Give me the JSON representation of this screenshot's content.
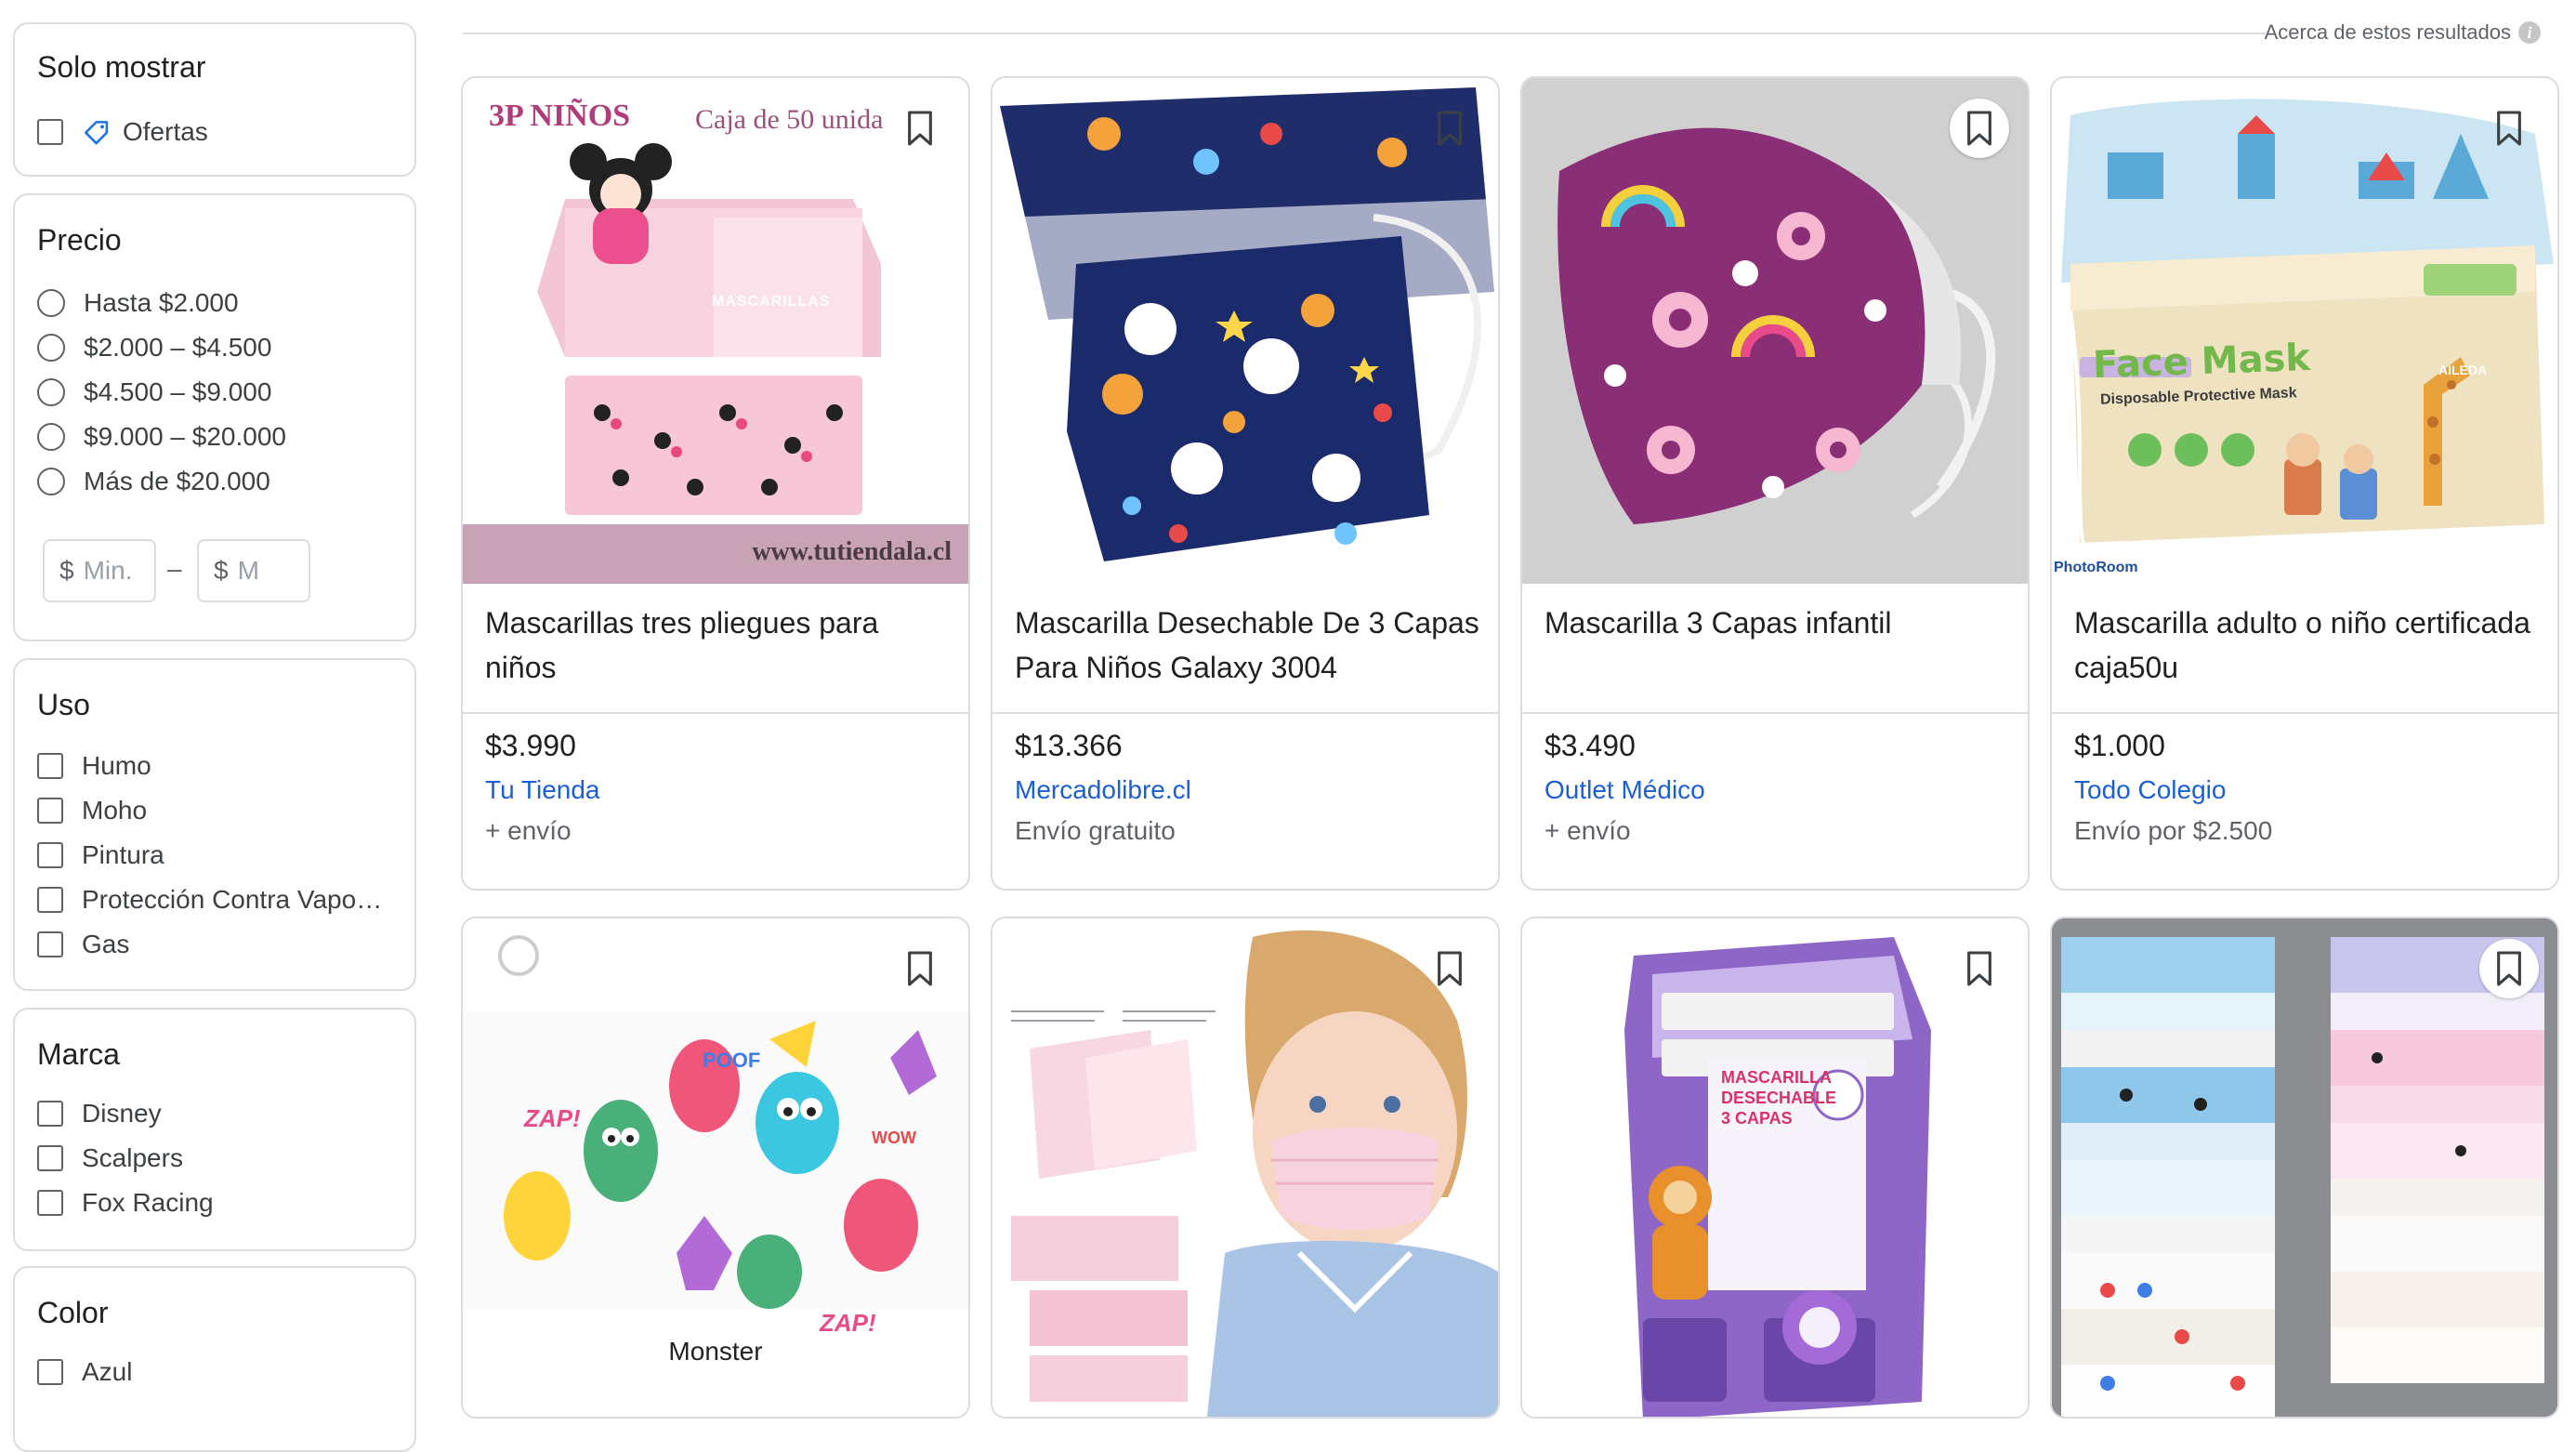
{
  "header": {
    "about": "Acerca de estos resultados"
  },
  "sidebar": {
    "show_only": {
      "title": "Solo mostrar",
      "offers": "Ofertas"
    },
    "price": {
      "title": "Precio",
      "options": [
        "Hasta $2.000",
        "$2.000 – $4.500",
        "$4.500 – $9.000",
        "$9.000 – $20.000",
        "Más de $20.000"
      ],
      "min_currency": "$",
      "min_placeholder": "Min.",
      "max_currency": "$",
      "max_placeholder": "M",
      "dash": "–"
    },
    "uso": {
      "title": "Uso",
      "options": [
        "Humo",
        "Moho",
        "Pintura",
        "Protección Contra Vapo…",
        "Gas"
      ]
    },
    "marca": {
      "title": "Marca",
      "options": [
        "Disney",
        "Scalpers",
        "Fox Racing"
      ]
    },
    "color": {
      "title": "Color",
      "options": [
        "Azul"
      ]
    }
  },
  "products": [
    {
      "title": "Mascarillas tres pliegues para niños",
      "price": "$3.990",
      "store": "Tu Tienda",
      "shipping": "+ envío",
      "image_text": {
        "top_left": "3P NIÑOS",
        "top_right": "Caja de 50 unida",
        "bottom": "www.tutiendala.cl",
        "box": "MASCARILLAS"
      }
    },
    {
      "title": "Mascarilla Desechable De 3 Capas Para Niños Galaxy 3004",
      "price": "$13.366",
      "store": "Mercadolibre.cl",
      "shipping": "Envío gratuito"
    },
    {
      "title": "Mascarilla 3 Capas infantil",
      "price": "$3.490",
      "store": "Outlet Médico",
      "shipping": "+ envío"
    },
    {
      "title": "Mascarilla adulto o niño certificada caja50u",
      "price": "$1.000",
      "store": "Todo Colegio",
      "shipping": "Envío por $2.500",
      "image_text": {
        "box": "Face Mask",
        "sub": "Disposable Protective Mask",
        "brand": "AILEDA",
        "watermark": "PhotoRoom"
      }
    },
    {
      "caption": "Monster",
      "image_text": {
        "a": "ZAP!",
        "b": "POOF",
        "c": "WOW",
        "d": "ZAP!"
      }
    },
    {
      "caption": ""
    },
    {
      "image_text": {
        "box": "MASCARILLA DESECHABLE 3 CAPAS"
      }
    },
    {
      "caption": ""
    }
  ],
  "colors": {
    "link": "#1a5fd6",
    "border": "#dadce0",
    "text": "#202124",
    "muted": "#5f6368"
  }
}
